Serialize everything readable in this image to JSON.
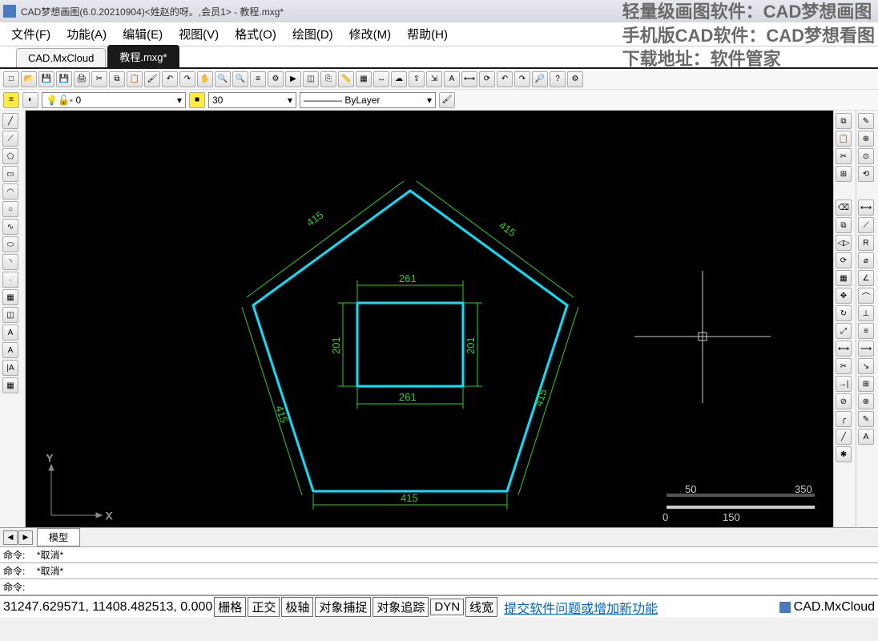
{
  "title": "CAD梦想画图(6.0.20210904)<姓赵的呀。,会员1> - 教程.mxg*",
  "menu": [
    "文件(F)",
    "功能(A)",
    "编辑(E)",
    "视图(V)",
    "格式(O)",
    "绘图(D)",
    "修改(M)",
    "帮助(H)"
  ],
  "tabs": [
    {
      "label": "CAD.MxCloud",
      "active": false
    },
    {
      "label": "教程.mxg*",
      "active": true
    }
  ],
  "layer": {
    "value": "0"
  },
  "lineweight": {
    "value": "30"
  },
  "linetype": {
    "value": "ByLayer"
  },
  "watermark": {
    "line1": "轻量级画图软件：CAD梦想画图",
    "line2": "手机版CAD软件：CAD梦想看图",
    "line3": "下载地址：软件管家"
  },
  "drawing": {
    "pentagon_side": "415",
    "rect_w": "261",
    "rect_h": "201"
  },
  "scalebar": {
    "v1": "0",
    "v2": "50",
    "v3": "150",
    "v4": "350"
  },
  "ucs": {
    "x": "X",
    "y": "Y"
  },
  "sheet_tab": "模型",
  "cmd": {
    "prompt": "命令:",
    "cancel": "*取消*"
  },
  "status": {
    "coords": "31247.629571, 11408.482513, 0.000",
    "grid": "栅格",
    "ortho": "正交",
    "polar": "极轴",
    "osnap": "对象捕捉",
    "otrack": "对象追踪",
    "dyn": "DYN",
    "lwt": "线宽",
    "feedback": "提交软件问题或增加新功能",
    "brand": "CAD.MxCloud"
  }
}
